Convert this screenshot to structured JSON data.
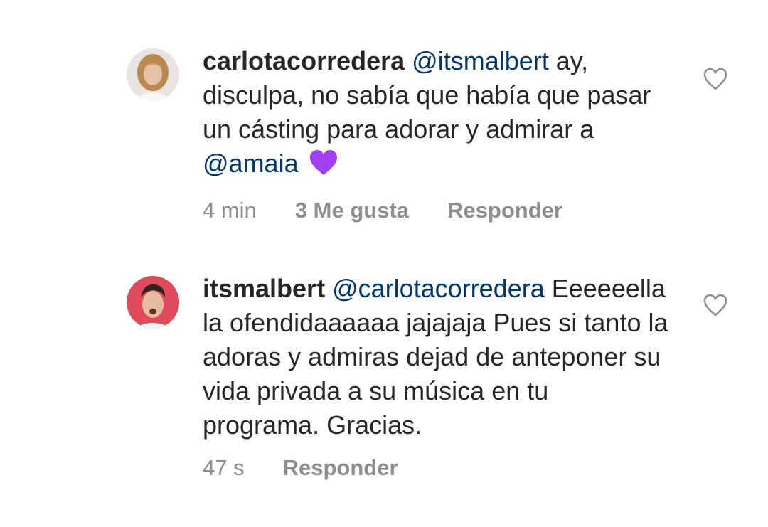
{
  "comments": [
    {
      "username": "carlotacorredera",
      "segments": [
        {
          "type": "mention",
          "text": "@itsmalbert"
        },
        {
          "type": "text",
          "text": " ay, disculpa, no sabía que había que pasar un cásting para adorar y admirar a "
        },
        {
          "type": "mention",
          "text": "@amaia"
        }
      ],
      "emoji": "purple-heart",
      "time": "4 min",
      "likes": "3 Me gusta",
      "reply_label": "Responder"
    },
    {
      "username": "itsmalbert",
      "segments": [
        {
          "type": "mention",
          "text": "@carlotacorredera"
        },
        {
          "type": "text",
          "text": " Eeeeeella la ofendidaaaaaa jajajaja Pues si tanto la adoras y admiras dejad de anteponer su vida privada a su música en tu programa. Gracias."
        }
      ],
      "time": "47 s",
      "reply_label": "Responder"
    }
  ],
  "icons": {
    "like": "heart-outline-icon",
    "emoji": "purple-heart-emoji"
  },
  "colors": {
    "text": "#262626",
    "mention": "#00376b",
    "meta": "#8e8e8e",
    "emoji": "#a23ff0"
  }
}
